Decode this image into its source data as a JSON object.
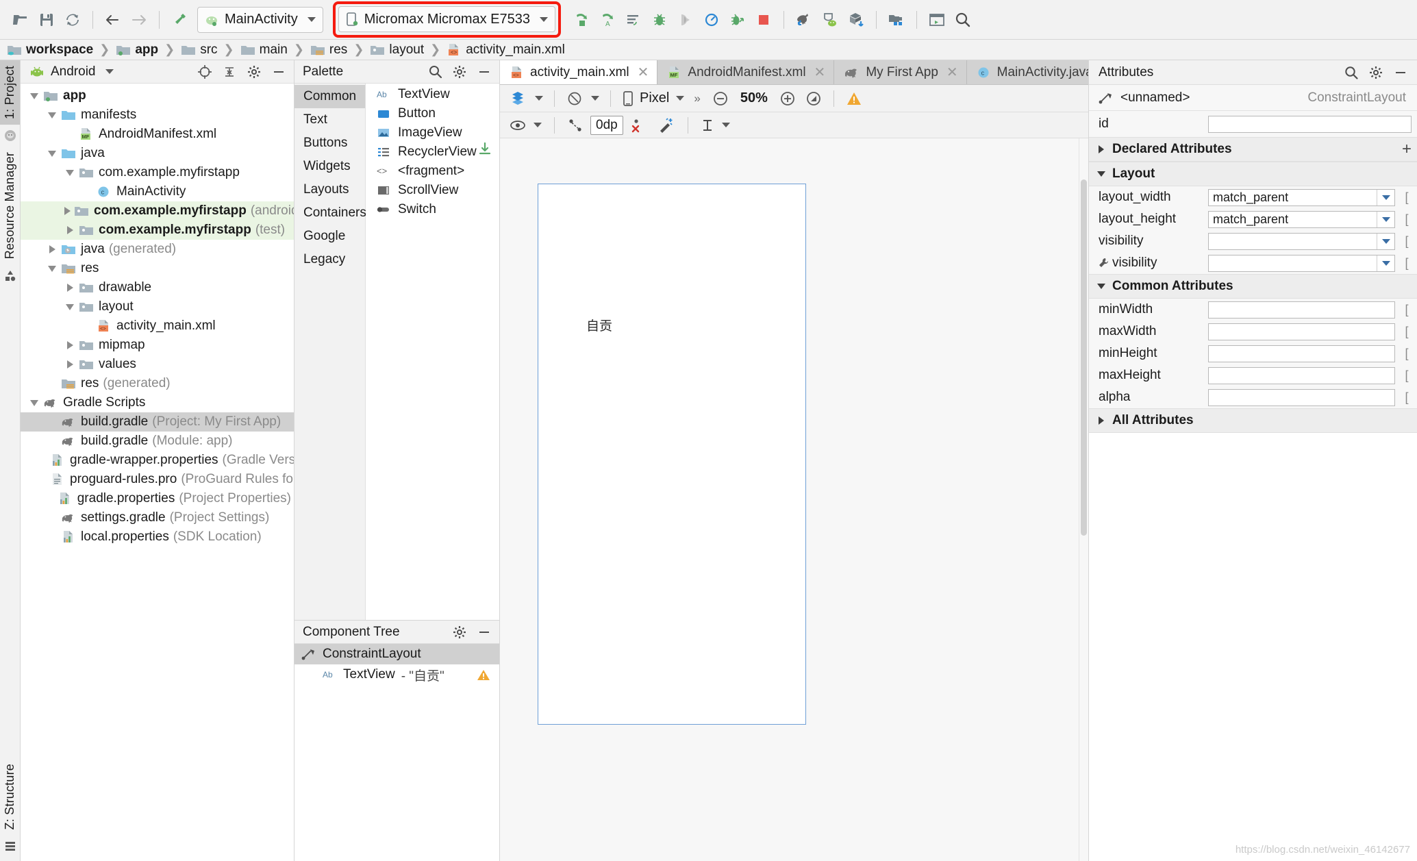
{
  "toolbar": {
    "icons": [
      {
        "name": "open-folder-icon",
        "title": "Open"
      },
      {
        "name": "save-all-icon",
        "title": "Save All"
      },
      {
        "name": "sync-icon",
        "title": "Sync Project"
      },
      {
        "name": "back-arrow-icon",
        "title": "Back"
      },
      {
        "name": "forward-arrow-icon",
        "title": "Forward"
      },
      {
        "name": "build-hammer-icon",
        "title": "Make Project"
      }
    ],
    "run_config": "MainActivity",
    "device": "Micromax Micromax E7533",
    "right_icons": [
      {
        "name": "run-icon",
        "title": "Run"
      },
      {
        "name": "apply-changes-icon",
        "title": "Apply Changes"
      },
      {
        "name": "run-with-coverage-icon",
        "title": "Run with Coverage"
      },
      {
        "name": "debug-icon",
        "title": "Debug"
      },
      {
        "name": "attach-debugger-icon",
        "title": "Attach Debugger"
      },
      {
        "name": "profiler-icon",
        "title": "Profile"
      },
      {
        "name": "debug-apk-icon",
        "title": "Debug APK"
      },
      {
        "name": "stop-icon",
        "title": "Stop"
      },
      {
        "name": "gradle-sync-icon",
        "title": "Sync Project with Gradle Files"
      },
      {
        "name": "avd-manager-icon",
        "title": "AVD Manager"
      },
      {
        "name": "sdk-manager-icon",
        "title": "SDK Manager"
      },
      {
        "name": "project-structure-icon",
        "title": "Project Structure"
      },
      {
        "name": "layout-inspector-icon",
        "title": "Layout Inspector"
      },
      {
        "name": "search-everywhere-icon",
        "title": "Search Everywhere"
      }
    ]
  },
  "breadcrumb": [
    {
      "label": "workspace",
      "icon": "module-folder-icon",
      "bold": true
    },
    {
      "label": "app",
      "icon": "app-folder-icon",
      "bold": true
    },
    {
      "label": "src",
      "icon": "folder-icon",
      "bold": false
    },
    {
      "label": "main",
      "icon": "folder-icon",
      "bold": false
    },
    {
      "label": "res",
      "icon": "res-folder-icon",
      "bold": false
    },
    {
      "label": "layout",
      "icon": "folder-icon",
      "bold": false
    },
    {
      "label": "activity_main.xml",
      "icon": "xml-layout-icon",
      "bold": false
    }
  ],
  "left_strip": {
    "tabs": [
      {
        "label": "1: Project",
        "selected": true,
        "name": "tool-tab-project"
      },
      {
        "label": "Resource Manager",
        "selected": false,
        "name": "tool-tab-resource-manager"
      }
    ],
    "bottom_tabs": [
      {
        "label": "Z: Structure",
        "name": "tool-tab-structure"
      }
    ]
  },
  "project_panel": {
    "title": "Android",
    "header_icons": [
      {
        "name": "locate-target-icon"
      },
      {
        "name": "collapse-all-icon"
      },
      {
        "name": "settings-gear-icon"
      },
      {
        "name": "hide-panel-icon"
      }
    ],
    "tree": [
      {
        "indent": 0,
        "twisty": "down",
        "icon": "app-folder-icon",
        "label": "app",
        "sub": "",
        "bold": true,
        "highlight": ""
      },
      {
        "indent": 1,
        "twisty": "down",
        "icon": "blue-folder-icon",
        "label": "manifests",
        "sub": "",
        "bold": false,
        "highlight": ""
      },
      {
        "indent": 2,
        "twisty": "none",
        "icon": "manifest-file-icon",
        "label": "AndroidManifest.xml",
        "sub": "",
        "bold": false,
        "highlight": ""
      },
      {
        "indent": 1,
        "twisty": "down",
        "icon": "blue-folder-icon",
        "label": "java",
        "sub": "",
        "bold": false,
        "highlight": ""
      },
      {
        "indent": 2,
        "twisty": "down",
        "icon": "package-folder-icon",
        "label": "com.example.myfirstapp",
        "sub": "",
        "bold": false,
        "highlight": ""
      },
      {
        "indent": 3,
        "twisty": "none",
        "icon": "java-class-icon",
        "label": "MainActivity",
        "sub": "",
        "bold": false,
        "highlight": ""
      },
      {
        "indent": 2,
        "twisty": "right",
        "icon": "package-folder-icon",
        "label": "com.example.myfirstapp",
        "sub": "(androidTest)",
        "bold": true,
        "highlight": "green"
      },
      {
        "indent": 2,
        "twisty": "right",
        "icon": "package-folder-icon",
        "label": "com.example.myfirstapp",
        "sub": "(test)",
        "bold": true,
        "highlight": "green"
      },
      {
        "indent": 1,
        "twisty": "right",
        "icon": "generated-folder-icon",
        "label": "java",
        "sub": "(generated)",
        "bold": false,
        "highlight": ""
      },
      {
        "indent": 1,
        "twisty": "down",
        "icon": "res-folder-icon",
        "label": "res",
        "sub": "",
        "bold": false,
        "highlight": ""
      },
      {
        "indent": 2,
        "twisty": "right",
        "icon": "package-folder-icon",
        "label": "drawable",
        "sub": "",
        "bold": false,
        "highlight": ""
      },
      {
        "indent": 2,
        "twisty": "down",
        "icon": "package-folder-icon",
        "label": "layout",
        "sub": "",
        "bold": false,
        "highlight": ""
      },
      {
        "indent": 3,
        "twisty": "none",
        "icon": "xml-layout-icon",
        "label": "activity_main.xml",
        "sub": "",
        "bold": false,
        "highlight": ""
      },
      {
        "indent": 2,
        "twisty": "right",
        "icon": "package-folder-icon",
        "label": "mipmap",
        "sub": "",
        "bold": false,
        "highlight": ""
      },
      {
        "indent": 2,
        "twisty": "right",
        "icon": "package-folder-icon",
        "label": "values",
        "sub": "",
        "bold": false,
        "highlight": ""
      },
      {
        "indent": 1,
        "twisty": "none",
        "icon": "res-folder-icon",
        "label": "res",
        "sub": "(generated)",
        "bold": false,
        "highlight": ""
      },
      {
        "indent": 0,
        "twisty": "down",
        "icon": "gradle-elephant-icon",
        "label": "Gradle Scripts",
        "sub": "",
        "bold": false,
        "highlight": ""
      },
      {
        "indent": 1,
        "twisty": "none",
        "icon": "gradle-elephant-icon",
        "label": "build.gradle",
        "sub": "(Project: My First App)",
        "bold": false,
        "highlight": "gray"
      },
      {
        "indent": 1,
        "twisty": "none",
        "icon": "gradle-elephant-icon",
        "label": "build.gradle",
        "sub": "(Module: app)",
        "bold": false,
        "highlight": ""
      },
      {
        "indent": 1,
        "twisty": "none",
        "icon": "properties-file-icon",
        "label": "gradle-wrapper.properties",
        "sub": "(Gradle Version)",
        "bold": false,
        "highlight": ""
      },
      {
        "indent": 1,
        "twisty": "none",
        "icon": "text-file-icon",
        "label": "proguard-rules.pro",
        "sub": "(ProGuard Rules for app)",
        "bold": false,
        "highlight": ""
      },
      {
        "indent": 1,
        "twisty": "none",
        "icon": "properties-file-icon",
        "label": "gradle.properties",
        "sub": "(Project Properties)",
        "bold": false,
        "highlight": ""
      },
      {
        "indent": 1,
        "twisty": "none",
        "icon": "gradle-elephant-icon",
        "label": "settings.gradle",
        "sub": "(Project Settings)",
        "bold": false,
        "highlight": ""
      },
      {
        "indent": 1,
        "twisty": "none",
        "icon": "properties-file-icon",
        "label": "local.properties",
        "sub": "(SDK Location)",
        "bold": false,
        "highlight": ""
      }
    ]
  },
  "palette": {
    "title": "Palette",
    "header_icons": [
      {
        "name": "search-icon"
      },
      {
        "name": "settings-gear-icon"
      },
      {
        "name": "hide-panel-icon"
      }
    ],
    "categories": [
      {
        "label": "Common",
        "selected": true
      },
      {
        "label": "Text",
        "selected": false
      },
      {
        "label": "Buttons",
        "selected": false
      },
      {
        "label": "Widgets",
        "selected": false
      },
      {
        "label": "Layouts",
        "selected": false
      },
      {
        "label": "Containers",
        "selected": false
      },
      {
        "label": "Google",
        "selected": false
      },
      {
        "label": "Legacy",
        "selected": false
      }
    ],
    "items": [
      {
        "label": "TextView",
        "icon": "textview-icon"
      },
      {
        "label": "Button",
        "icon": "button-icon"
      },
      {
        "label": "ImageView",
        "icon": "imageview-icon"
      },
      {
        "label": "RecyclerView",
        "icon": "recyclerview-icon",
        "download": true
      },
      {
        "label": "<fragment>",
        "icon": "fragment-icon"
      },
      {
        "label": "ScrollView",
        "icon": "scrollview-icon"
      },
      {
        "label": "Switch",
        "icon": "switch-icon"
      }
    ]
  },
  "component_tree": {
    "title": "Component Tree",
    "header_icons": [
      {
        "name": "settings-gear-icon"
      },
      {
        "name": "hide-panel-icon"
      }
    ],
    "rows": [
      {
        "indent": 0,
        "icon": "constraintlayout-icon",
        "label": "ConstraintLayout",
        "detail": "",
        "selected": true,
        "warning": false
      },
      {
        "indent": 1,
        "icon": "textview-icon",
        "label": "TextView",
        "detail": "- \"自贡\"",
        "selected": false,
        "warning": true
      }
    ]
  },
  "editor_tabs": [
    {
      "label": "activity_main.xml",
      "icon": "xml-layout-icon",
      "active": true,
      "closable": true
    },
    {
      "label": "AndroidManifest.xml",
      "icon": "manifest-file-icon",
      "active": false,
      "closable": true
    },
    {
      "label": "My First App",
      "icon": "gradle-elephant-icon",
      "active": false,
      "closable": true
    },
    {
      "label": "MainActivity.java",
      "icon": "java-class-icon",
      "active": false,
      "closable": true
    }
  ],
  "design_toolbar": {
    "view_mode_icon": "design-surface-icon",
    "orientation_icon": "rotate-orientation-icon",
    "device_icon": "phone-icon",
    "device": "Pixel",
    "overflow": "»",
    "zoom_out_icon": "zoom-out-icon",
    "zoom_level": "50%",
    "zoom_in_icon": "zoom-in-icon",
    "zoom_fit_icon": "zoom-to-fit-icon",
    "warning_icon": "warning-triangle-icon",
    "row2": {
      "eye_icon": "visibility-eye-icon",
      "autoconnect_icon": "autoconnect-icon",
      "margin_value": "0dp",
      "clear_constraints_icon": "clear-constraints-icon",
      "infer_constraints_icon": "infer-constraints-icon",
      "guidelines_icon": "add-guideline-icon"
    }
  },
  "canvas": {
    "preview_text": "自贡"
  },
  "attributes": {
    "title": "Attributes",
    "header_icons": [
      {
        "name": "search-icon"
      },
      {
        "name": "settings-gear-icon"
      },
      {
        "name": "hide-panel-icon"
      }
    ],
    "selection_name": "<unnamed>",
    "selection_type": "ConstraintLayout",
    "id_label": "id",
    "id_value": "",
    "sections": [
      {
        "title": "Declared Attributes",
        "expanded": false,
        "has_plus": true,
        "rows": []
      },
      {
        "title": "Layout",
        "expanded": true,
        "has_plus": false,
        "rows": [
          {
            "label": "layout_width",
            "value": "match_parent",
            "type": "combo",
            "icon": ""
          },
          {
            "label": "layout_height",
            "value": "match_parent",
            "type": "combo",
            "icon": ""
          },
          {
            "label": "visibility",
            "value": "",
            "type": "combo",
            "icon": ""
          },
          {
            "label": "visibility",
            "value": "",
            "type": "combo",
            "icon": "wrench-icon"
          }
        ]
      },
      {
        "title": "Common Attributes",
        "expanded": true,
        "has_plus": false,
        "rows": [
          {
            "label": "minWidth",
            "value": "",
            "type": "text",
            "icon": ""
          },
          {
            "label": "maxWidth",
            "value": "",
            "type": "text",
            "icon": ""
          },
          {
            "label": "minHeight",
            "value": "",
            "type": "text",
            "icon": ""
          },
          {
            "label": "maxHeight",
            "value": "",
            "type": "text",
            "icon": ""
          },
          {
            "label": "alpha",
            "value": "",
            "type": "text",
            "icon": ""
          }
        ]
      },
      {
        "title": "All Attributes",
        "expanded": false,
        "has_plus": false,
        "rows": []
      }
    ],
    "watermark": "https://blog.csdn.net/weixin_46142677"
  }
}
